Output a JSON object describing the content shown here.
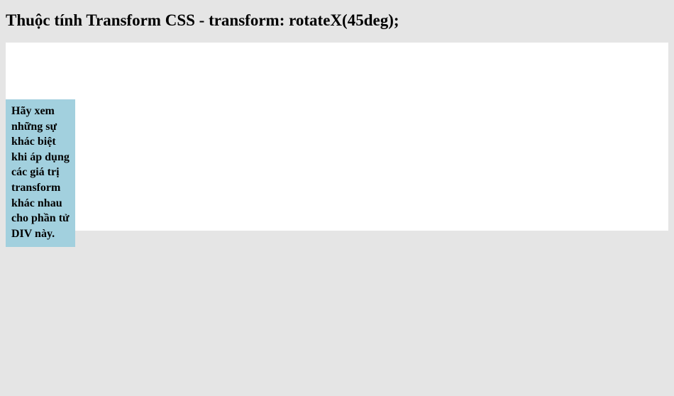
{
  "heading": "Thuộc tính Transform CSS - transform: rotateX(45deg);",
  "box_text": "Hãy xem những sự khác biệt khi áp dụng các giá trị transform khác nhau cho phần tử DIV này."
}
